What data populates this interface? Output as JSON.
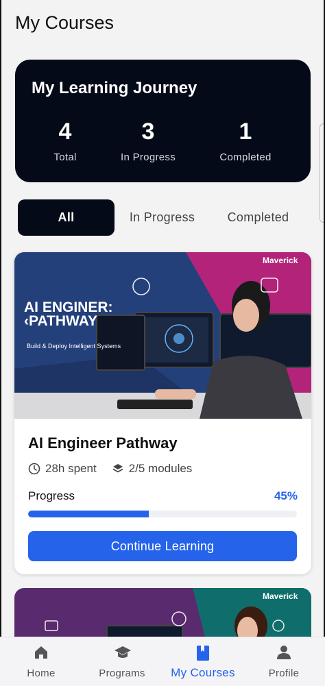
{
  "page": {
    "title": "My Courses"
  },
  "stats": {
    "heading": "My Learning Journey",
    "items": [
      {
        "value": "4",
        "label": "Total"
      },
      {
        "value": "3",
        "label": "In Progress"
      },
      {
        "value": "1",
        "label": "Completed"
      }
    ]
  },
  "filters": {
    "tabs": [
      {
        "label": "All",
        "active": true
      },
      {
        "label": "In Progress",
        "active": false
      },
      {
        "label": "Completed",
        "active": false
      }
    ]
  },
  "courses": [
    {
      "banner": {
        "brand": "Maverick",
        "headline_line1": "AI ENGINER:",
        "headline_line2": "‹PATHWAY",
        "tagline": "Build & Deploy Intelligent Systems"
      },
      "title": "AI Engineer Pathway",
      "time_spent": "28h spent",
      "modules": "2/5 modules",
      "progress_label": "Progress",
      "progress_text": "45%",
      "progress_value": 0.45,
      "cta": "Continue Learning"
    },
    {
      "banner": {
        "brand": "Maverick"
      }
    }
  ],
  "nav": {
    "items": [
      {
        "label": "Home",
        "icon": "home-icon",
        "active": false
      },
      {
        "label": "Programs",
        "icon": "graduation-cap-icon",
        "active": false
      },
      {
        "label": "My Courses",
        "icon": "book-icon",
        "active": true
      },
      {
        "label": "Profile",
        "icon": "person-icon",
        "active": false
      }
    ]
  },
  "colors": {
    "accent": "#2563eb",
    "dark": "#050a18",
    "banner_pink": "#b3237a",
    "banner_blue": "#24407a",
    "banner_teal": "#0f6d6b"
  }
}
